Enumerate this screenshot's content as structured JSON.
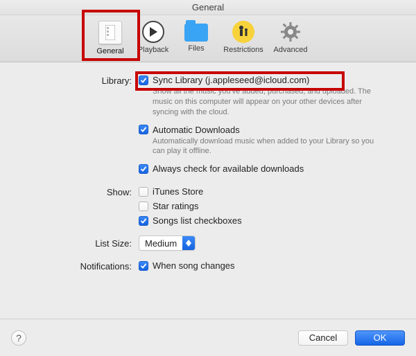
{
  "title": "General",
  "toolbar": {
    "general": "General",
    "playback": "Playback",
    "files": "Files",
    "restrictions": "Restrictions",
    "advanced": "Advanced"
  },
  "library": {
    "label": "Library:",
    "sync": {
      "checked": true,
      "text": "Sync Library (j.appleseed@icloud.com)",
      "desc": "Show all the music you've added, purchased, and uploaded. The music on this computer will appear on your other devices after syncing with the cloud."
    },
    "auto": {
      "checked": true,
      "text": "Automatic Downloads",
      "desc": "Automatically download music when added to your Library so you can play it offline."
    },
    "always": {
      "checked": true,
      "text": "Always check for available downloads"
    }
  },
  "show": {
    "label": "Show:",
    "itunes": {
      "checked": false,
      "text": "iTunes Store"
    },
    "star": {
      "checked": false,
      "text": "Star ratings"
    },
    "songs": {
      "checked": true,
      "text": "Songs list checkboxes"
    }
  },
  "listsize": {
    "label": "List Size:",
    "value": "Medium"
  },
  "notifications": {
    "label": "Notifications:",
    "song": {
      "checked": true,
      "text": "When song changes"
    }
  },
  "buttons": {
    "help": "?",
    "cancel": "Cancel",
    "ok": "OK"
  }
}
